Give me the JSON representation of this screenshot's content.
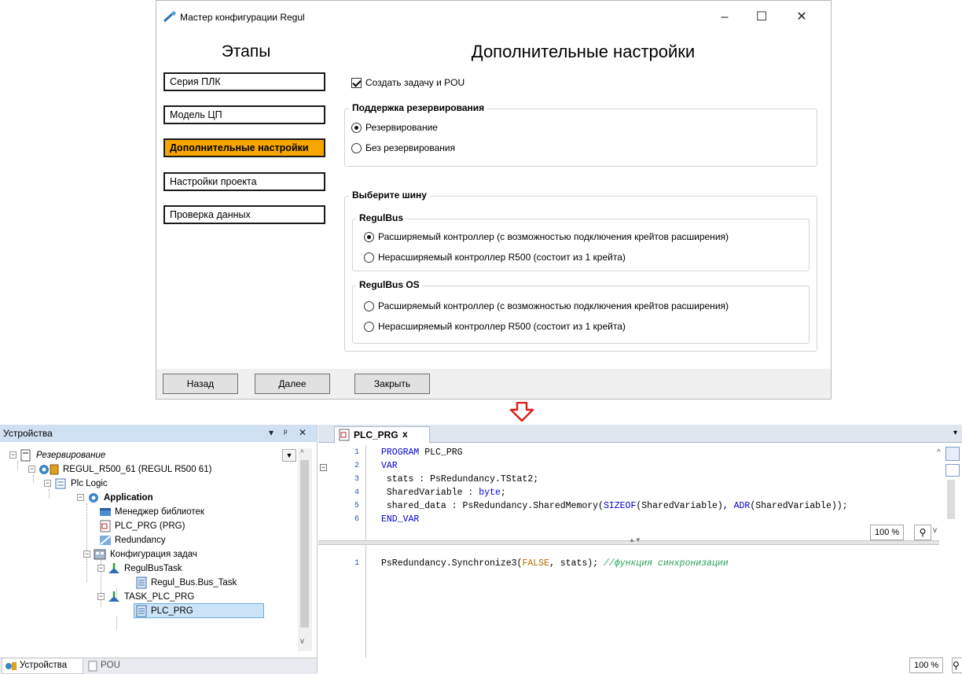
{
  "wizard": {
    "title": "Мастер конфигурации Regul",
    "stages_heading": "Этапы",
    "stages": [
      {
        "label": "Серия ПЛК",
        "active": false
      },
      {
        "label": "Модель ЦП",
        "active": false
      },
      {
        "label": "Дополнительные настройки",
        "active": true
      },
      {
        "label": "Настройки проекта",
        "active": false
      },
      {
        "label": "Проверка данных",
        "active": false
      }
    ],
    "active_color": "#f7a600",
    "page_heading": "Дополнительные настройки",
    "create_task": {
      "label": "Создать задачу и POU",
      "checked": true
    },
    "redundancy_group": {
      "title": "Поддержка резервирования",
      "options": [
        {
          "label": "Резервирование",
          "selected": true
        },
        {
          "label": "Без резервирования",
          "selected": false
        }
      ]
    },
    "bus_group": {
      "title": "Выберите шину",
      "regulbus": {
        "title": "RegulBus",
        "options": [
          {
            "label": "Расширяемый контроллер (с возможностью подключения крейтов расширения)",
            "selected": true
          },
          {
            "label": "Нерасширяемый контроллер R500 (состоит из 1 крейта)",
            "selected": false
          }
        ]
      },
      "regulbus_os": {
        "title": "RegulBus OS",
        "options": [
          {
            "label": "Расширяемый контроллер (с возможностью подключения крейтов расширения)",
            "selected": false
          },
          {
            "label": "Нерасширяемый контроллер R500 (состоит из 1 крейта)",
            "selected": false
          }
        ]
      }
    },
    "buttons": {
      "back": "Назад",
      "next": "Далее",
      "close": "Закрыть"
    },
    "window_controls": {
      "minimize": "–",
      "maximize": "☐",
      "close": "✕"
    }
  },
  "devices": {
    "title": "Устройства",
    "header_controls": {
      "dropdown": "▾",
      "pin": "ᵖ",
      "close": "✕"
    },
    "tree": [
      {
        "label": "Резервирование",
        "italic": true,
        "bold": false
      },
      {
        "label": "REGUL_R500_61 (REGUL R500 61)",
        "italic": false,
        "bold": false
      },
      {
        "label": "Plc Logic",
        "italic": false,
        "bold": false
      },
      {
        "label": "Application",
        "italic": false,
        "bold": true
      },
      {
        "label": "Менеджер библиотек",
        "italic": false,
        "bold": false
      },
      {
        "label": "PLC_PRG (PRG)",
        "italic": false,
        "bold": false
      },
      {
        "label": "Redundancy",
        "italic": false,
        "bold": false
      },
      {
        "label": "Конфигурация задач",
        "italic": false,
        "bold": false
      },
      {
        "label": "RegulBusTask",
        "italic": false,
        "bold": false
      },
      {
        "label": "Regul_Bus.Bus_Task",
        "italic": false,
        "bold": false
      },
      {
        "label": "TASK_PLC_PRG",
        "italic": false,
        "bold": false
      },
      {
        "label": "PLC_PRG",
        "italic": false,
        "bold": false,
        "selected": true
      }
    ],
    "tabs": [
      {
        "label": "Устройства",
        "icon": "devices-icon"
      },
      {
        "label": "POU",
        "icon": "pou-icon"
      }
    ]
  },
  "editor": {
    "tab_label": "PLC_PRG",
    "tab_close": "x",
    "declaration_lines": [
      {
        "n": "1",
        "parts": [
          {
            "t": "PROGRAM",
            "c": "kw"
          },
          {
            "t": " PLC_PRG",
            "c": ""
          }
        ]
      },
      {
        "n": "2",
        "parts": [
          {
            "t": "VAR",
            "c": "kw"
          }
        ]
      },
      {
        "n": "3",
        "parts": [
          {
            "t": " stats : PsRedundancy.TStat2;",
            "c": ""
          }
        ]
      },
      {
        "n": "4",
        "parts": [
          {
            "t": " SharedVariable : ",
            "c": ""
          },
          {
            "t": "byte",
            "c": "kw"
          },
          {
            "t": ";",
            "c": ""
          }
        ]
      },
      {
        "n": "5",
        "parts": [
          {
            "t": " shared_data : PsRedundancy.SharedMemory(",
            "c": ""
          },
          {
            "t": "SIZEOF",
            "c": "kw"
          },
          {
            "t": "(SharedVariable), ",
            "c": ""
          },
          {
            "t": "ADR",
            "c": "kw"
          },
          {
            "t": "(SharedVariable));",
            "c": ""
          }
        ]
      },
      {
        "n": "6",
        "parts": [
          {
            "t": "END_VAR",
            "c": "kw"
          }
        ]
      }
    ],
    "body_lines": [
      {
        "n": "1",
        "parts": [
          {
            "t": "PsRedundancy.Synchronize3(",
            "c": ""
          },
          {
            "t": "FALSE",
            "c": "lit"
          },
          {
            "t": ", stats); ",
            "c": ""
          },
          {
            "t": "//функция синхронизации",
            "c": "cmt"
          }
        ]
      }
    ],
    "zoom_top": "100 %",
    "zoom_bottom": "100 %"
  }
}
